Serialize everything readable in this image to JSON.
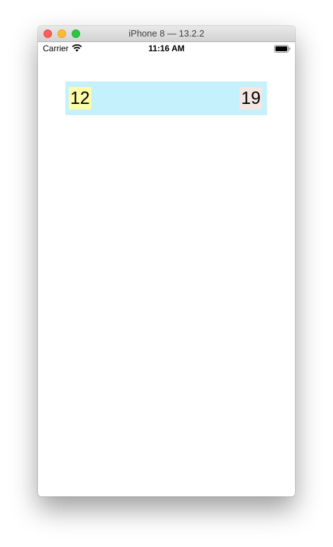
{
  "window": {
    "title": "iPhone 8 — 13.2.2"
  },
  "status_bar": {
    "carrier": "Carrier",
    "time": "11:16 AM"
  },
  "screen": {
    "left_label": "12",
    "right_label": "19"
  },
  "colors": {
    "row_background": "#c5f1fd",
    "left_label_background": "#fdfca8",
    "right_label_background": "#f4e7e1"
  },
  "icons": {
    "wifi": "wifi-icon",
    "battery": "battery-icon"
  }
}
